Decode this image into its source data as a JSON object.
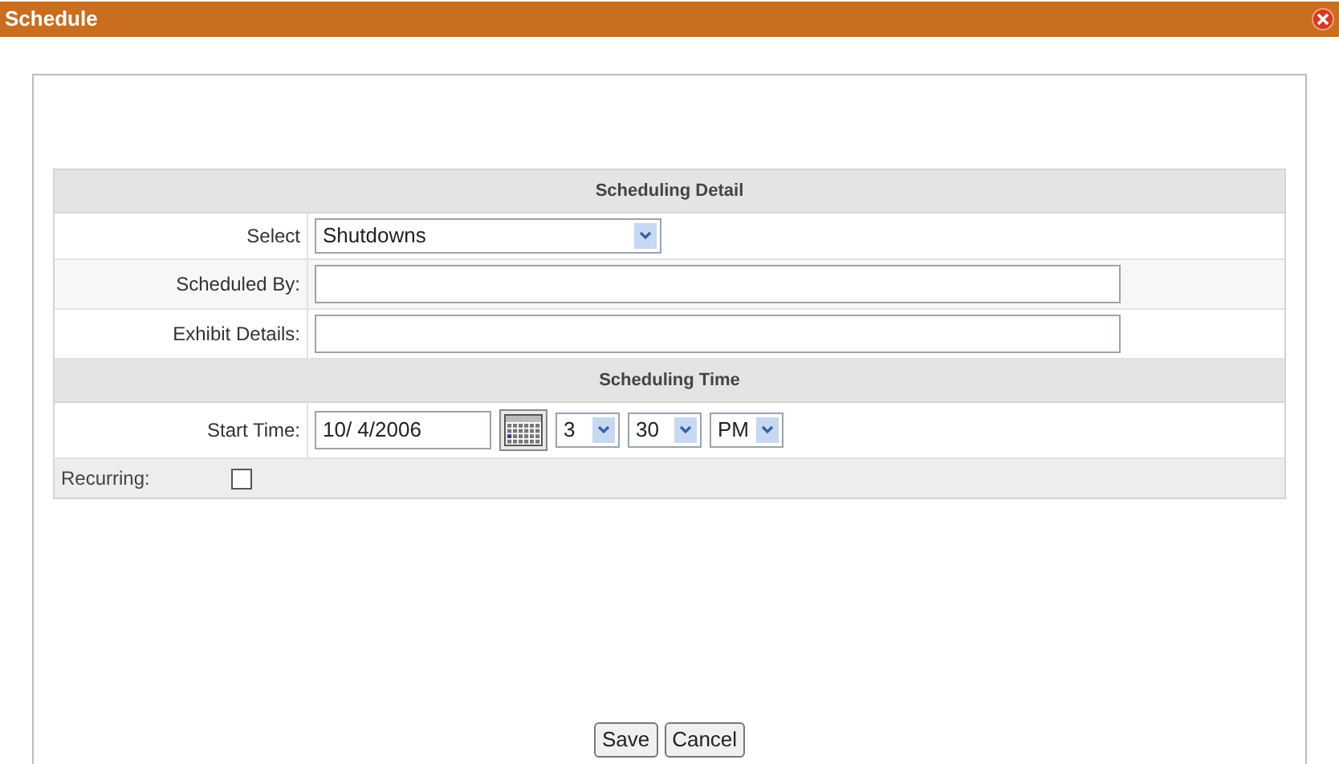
{
  "window": {
    "title": "Schedule"
  },
  "detail": {
    "heading": "Scheduling Detail",
    "select": {
      "label": "Select",
      "value": "Shutdowns"
    },
    "scheduled_by": {
      "label": "Scheduled By:"
    },
    "exhibit_details": {
      "label": "Exhibit Details:"
    }
  },
  "time": {
    "heading": "Scheduling Time",
    "label": "Start Time:",
    "date": "10/ 4/2006",
    "hour": "3",
    "minute": "30",
    "ampm": "PM"
  },
  "recurring": {
    "label": "Recurring:",
    "checked": false
  },
  "buttons": [
    "Save",
    "Cancel"
  ]
}
